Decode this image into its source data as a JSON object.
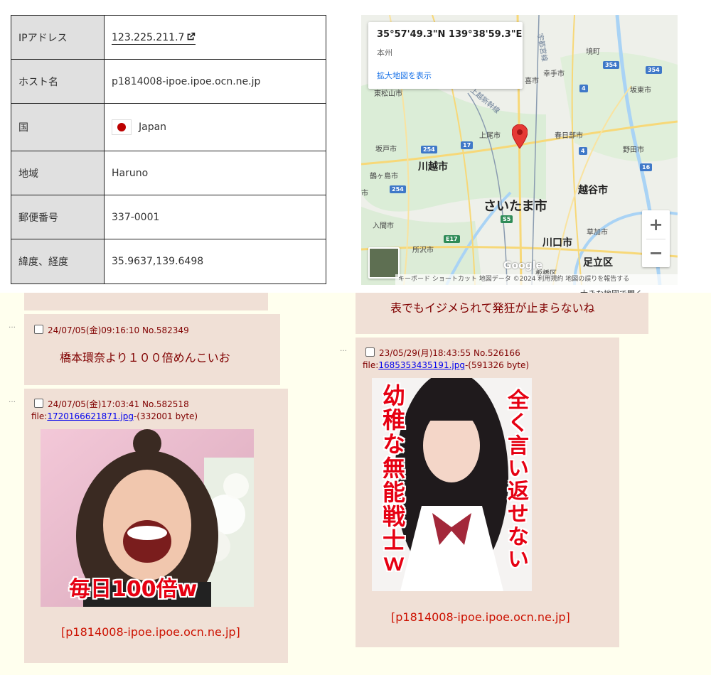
{
  "info_table": {
    "rows": [
      {
        "key": "IPアドレス",
        "value": "123.225.211.7"
      },
      {
        "key": "ホスト名",
        "value": "p1814008-ipoe.ipoe.ocn.ne.jp"
      },
      {
        "key": "国",
        "value": "Japan"
      },
      {
        "key": "地域",
        "value": "Haruno"
      },
      {
        "key": "郵便番号",
        "value": "337-0001"
      },
      {
        "key": "緯度、経度",
        "value": "35.9637,139.6498"
      }
    ]
  },
  "map": {
    "card": {
      "coord": "35°57'49.3\"N 139°38'59.3\"E",
      "region": "本州",
      "enlarge": "拡大地図を表示"
    },
    "labels": {
      "higashimatsuyama": "東松山市",
      "kawagoe": "川越市",
      "saitama": "さいたま市",
      "ageo": "上尾市",
      "kasukabe": "春日部市",
      "koshigaya": "越谷市",
      "kawaguchi": "川口市",
      "soka": "草加市",
      "adachi": "足立区",
      "tokorozawa": "所沢市",
      "iruma": "入間市",
      "tsurugashima": "鶴ヶ島市",
      "sakado": "坂戸市",
      "noda": "野田市",
      "bando": "坂東市",
      "sakaimachi": "境町",
      "satte": "幸手市",
      "kuki": "喜市",
      "joetsu": "上越新幹線",
      "utsunomiya": "宇都宮線",
      "itabashi": "板橋区",
      "left_edge": "市"
    },
    "shields": {
      "r254a": "254",
      "r17": "17",
      "r4a": "4",
      "r4b": "4",
      "r16": "16",
      "r354a": "354",
      "r354b": "354",
      "r254b": "254",
      "s5": "S5",
      "e17": "E17"
    },
    "zoom_in": "+",
    "zoom_out": "−",
    "google": "Google",
    "footer": "キーボード ショートカット   地図データ ©2024   利用規約   地図の誤りを報告する",
    "under": "大きな地図で開く"
  },
  "posts": {
    "p1": {
      "header": "24/07/05(金)09:16:10 No.582349",
      "body": "橋本環奈より１００倍めんこいお"
    },
    "p2": {
      "header": "24/07/05(金)17:03:41 No.582518",
      "file_prefix": "file:",
      "file_name": "1720166621871.jpg",
      "file_size": "-(332001 byte)",
      "image_caption": "毎日100倍w",
      "host": "[p1814008-ipoe.ipoe.ocn.ne.jp]"
    },
    "p3": {
      "body": "表でもイジメられて発狂が止まらないね"
    },
    "p4": {
      "header": "23/05/29(月)18:43:55 No.526166",
      "file_prefix": "file:",
      "file_name": "1685353435191.jpg",
      "file_size": "-(591326 byte)",
      "caption_left": "幼稚な無能戦士ｗ",
      "caption_right": "全く言い返せない",
      "host": "[p1814008-ipoe.ipoe.ocn.ne.jp]"
    },
    "dots": "…"
  }
}
